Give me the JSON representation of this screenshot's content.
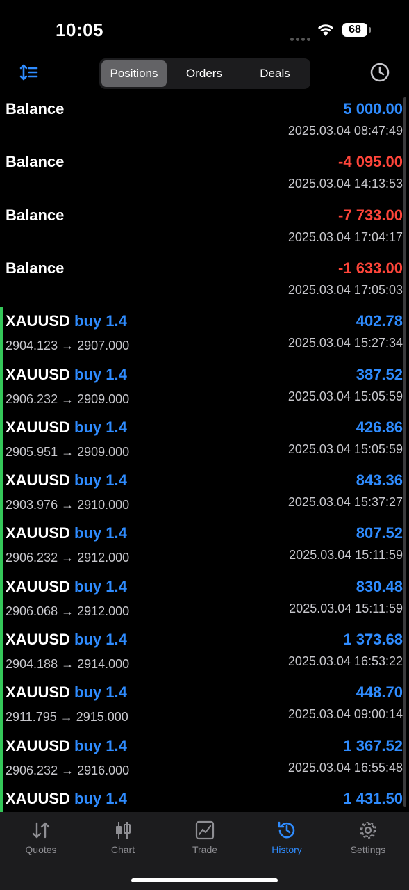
{
  "status": {
    "time": "10:05",
    "battery": "68"
  },
  "tabs_top": [
    "Positions",
    "Orders",
    "Deals"
  ],
  "rows": [
    {
      "type": "balance",
      "label": "Balance",
      "amount": "5 000.00",
      "sign": "pos",
      "datetime": "2025.03.04 08:47:49"
    },
    {
      "type": "balance",
      "label": "Balance",
      "amount": "-4 095.00",
      "sign": "neg",
      "datetime": "2025.03.04 14:13:53"
    },
    {
      "type": "balance",
      "label": "Balance",
      "amount": "-7 733.00",
      "sign": "neg",
      "datetime": "2025.03.04 17:04:17"
    },
    {
      "type": "balance",
      "label": "Balance",
      "amount": "-1 633.00",
      "sign": "neg",
      "datetime": "2025.03.04 17:05:03"
    },
    {
      "type": "trade",
      "symbol": "XAUUSD",
      "direction": "buy 1.4",
      "prices": "2904.123 → 2907.000",
      "amount": "402.78",
      "sign": "pos",
      "datetime": "2025.03.04 15:27:34"
    },
    {
      "type": "trade",
      "symbol": "XAUUSD",
      "direction": "buy 1.4",
      "prices": "2906.232 → 2909.000",
      "amount": "387.52",
      "sign": "pos",
      "datetime": "2025.03.04 15:05:59"
    },
    {
      "type": "trade",
      "symbol": "XAUUSD",
      "direction": "buy 1.4",
      "prices": "2905.951 → 2909.000",
      "amount": "426.86",
      "sign": "pos",
      "datetime": "2025.03.04 15:05:59"
    },
    {
      "type": "trade",
      "symbol": "XAUUSD",
      "direction": "buy 1.4",
      "prices": "2903.976 → 2910.000",
      "amount": "843.36",
      "sign": "pos",
      "datetime": "2025.03.04 15:37:27"
    },
    {
      "type": "trade",
      "symbol": "XAUUSD",
      "direction": "buy 1.4",
      "prices": "2906.232 → 2912.000",
      "amount": "807.52",
      "sign": "pos",
      "datetime": "2025.03.04 15:11:59"
    },
    {
      "type": "trade",
      "symbol": "XAUUSD",
      "direction": "buy 1.4",
      "prices": "2906.068 → 2912.000",
      "amount": "830.48",
      "sign": "pos",
      "datetime": "2025.03.04 15:11:59"
    },
    {
      "type": "trade",
      "symbol": "XAUUSD",
      "direction": "buy 1.4",
      "prices": "2904.188 → 2914.000",
      "amount": "1 373.68",
      "sign": "pos",
      "datetime": "2025.03.04 16:53:22"
    },
    {
      "type": "trade",
      "symbol": "XAUUSD",
      "direction": "buy 1.4",
      "prices": "2911.795 → 2915.000",
      "amount": "448.70",
      "sign": "pos",
      "datetime": "2025.03.04 09:00:14"
    },
    {
      "type": "trade",
      "symbol": "XAUUSD",
      "direction": "buy 1.4",
      "prices": "2906.232 → 2916.000",
      "amount": "1 367.52",
      "sign": "pos",
      "datetime": "2025.03.04 16:55:48"
    },
    {
      "type": "trade",
      "symbol": "XAUUSD",
      "direction": "buy 1.4",
      "prices": "",
      "amount": "1 431.50",
      "sign": "pos",
      "datetime": ""
    }
  ],
  "tabbar": [
    {
      "label": "Quotes",
      "icon": "quotes-icon"
    },
    {
      "label": "Chart",
      "icon": "chart-icon"
    },
    {
      "label": "Trade",
      "icon": "trade-icon"
    },
    {
      "label": "History",
      "icon": "history-icon",
      "active": true
    },
    {
      "label": "Settings",
      "icon": "settings-icon"
    }
  ],
  "colors": {
    "accent": "#2f8cff",
    "negative": "#ff453a",
    "trade_marker": "#34c759"
  }
}
